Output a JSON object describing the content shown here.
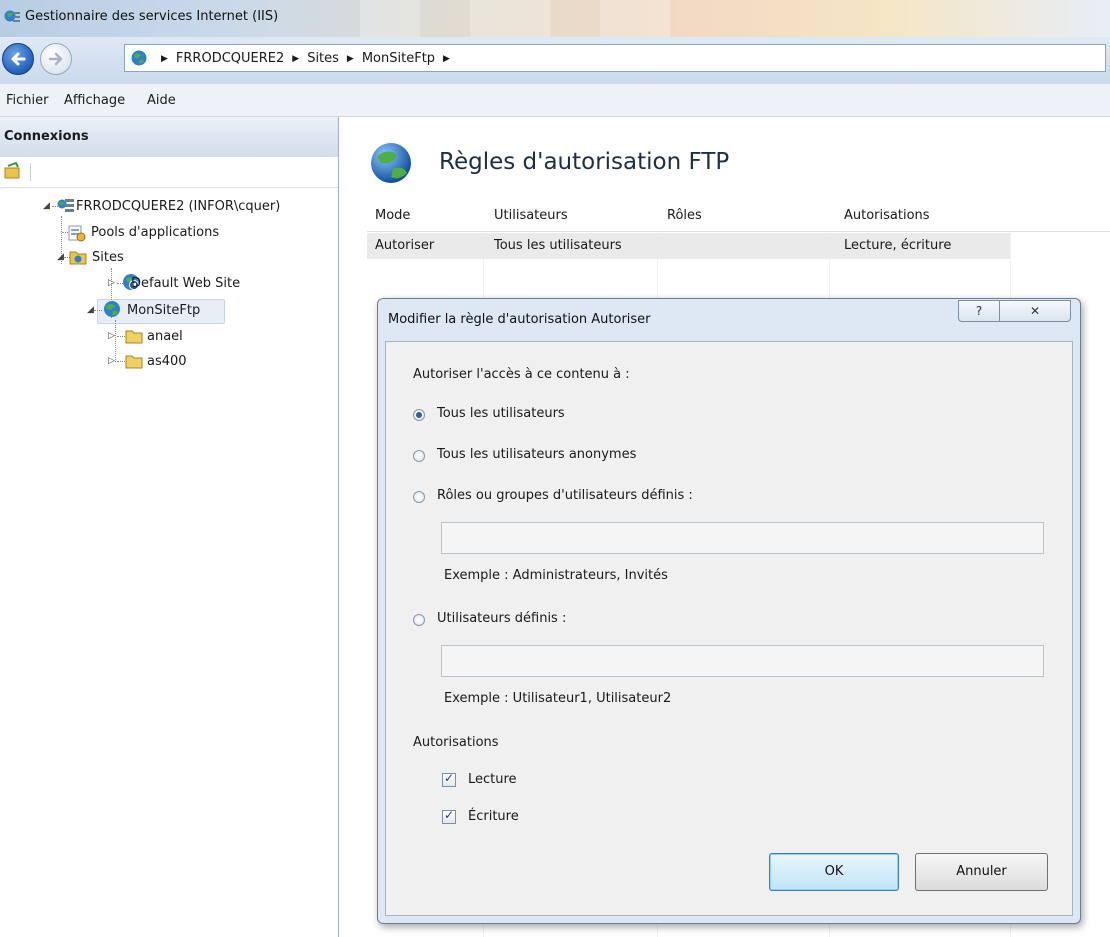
{
  "window": {
    "title": "Gestionnaire des services Internet (IIS)"
  },
  "address": {
    "crumbs": [
      "FRRODCQUERE2",
      "Sites",
      "MonSiteFtp"
    ]
  },
  "menu": {
    "items": [
      "Fichier",
      "Affichage",
      "Aide"
    ]
  },
  "connections": {
    "header": "Connexions",
    "tree": {
      "server": "FRRODCQUERE2 (INFOR\\cquer)",
      "pools": "Pools d'applications",
      "sites": "Sites",
      "default_site": "Default Web Site",
      "ftp_site": "MonSiteFtp",
      "folder1": "anael",
      "folder2": "as400"
    }
  },
  "main": {
    "title": "Règles d'autorisation FTP",
    "columns": [
      "Mode",
      "Utilisateurs",
      "Rôles",
      "Autorisations"
    ],
    "rows": [
      {
        "mode": "Autoriser",
        "users": "Tous les utilisateurs",
        "roles": "",
        "permissions": "Lecture, écriture"
      }
    ]
  },
  "dialog": {
    "title": "Modifier la règle d'autorisation Autoriser",
    "help_glyph": "?",
    "close_glyph": "✕",
    "prompt": "Autoriser l'accès à ce contenu à :",
    "options": {
      "all_users": "Tous les utilisateurs",
      "anonymous": "Tous les utilisateurs anonymes",
      "roles": "Rôles ou groupes d'utilisateurs définis :",
      "specified": "Utilisateurs définis :"
    },
    "selected_option": "all_users",
    "roles_example": "Exemple : Administrateurs, Invités",
    "users_example": "Exemple : Utilisateur1, Utilisateur2",
    "roles_value": "",
    "users_value": "",
    "permissions_label": "Autorisations",
    "read_label": "Lecture",
    "write_label": "Écriture",
    "read_checked": true,
    "write_checked": true,
    "ok_label": "OK",
    "cancel_label": "Annuler"
  }
}
